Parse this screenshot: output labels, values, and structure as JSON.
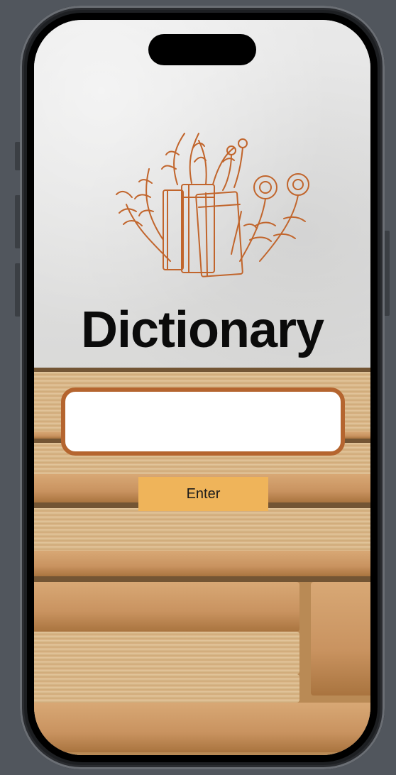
{
  "app": {
    "title": "Dictionary"
  },
  "search": {
    "value": "",
    "placeholder": ""
  },
  "actions": {
    "enter_label": "Enter"
  },
  "colors": {
    "accent": "#b5652f",
    "button": "#efb45a",
    "title_text": "#0b0b0b"
  },
  "icons": {
    "logo": "books-with-flowers-icon"
  }
}
